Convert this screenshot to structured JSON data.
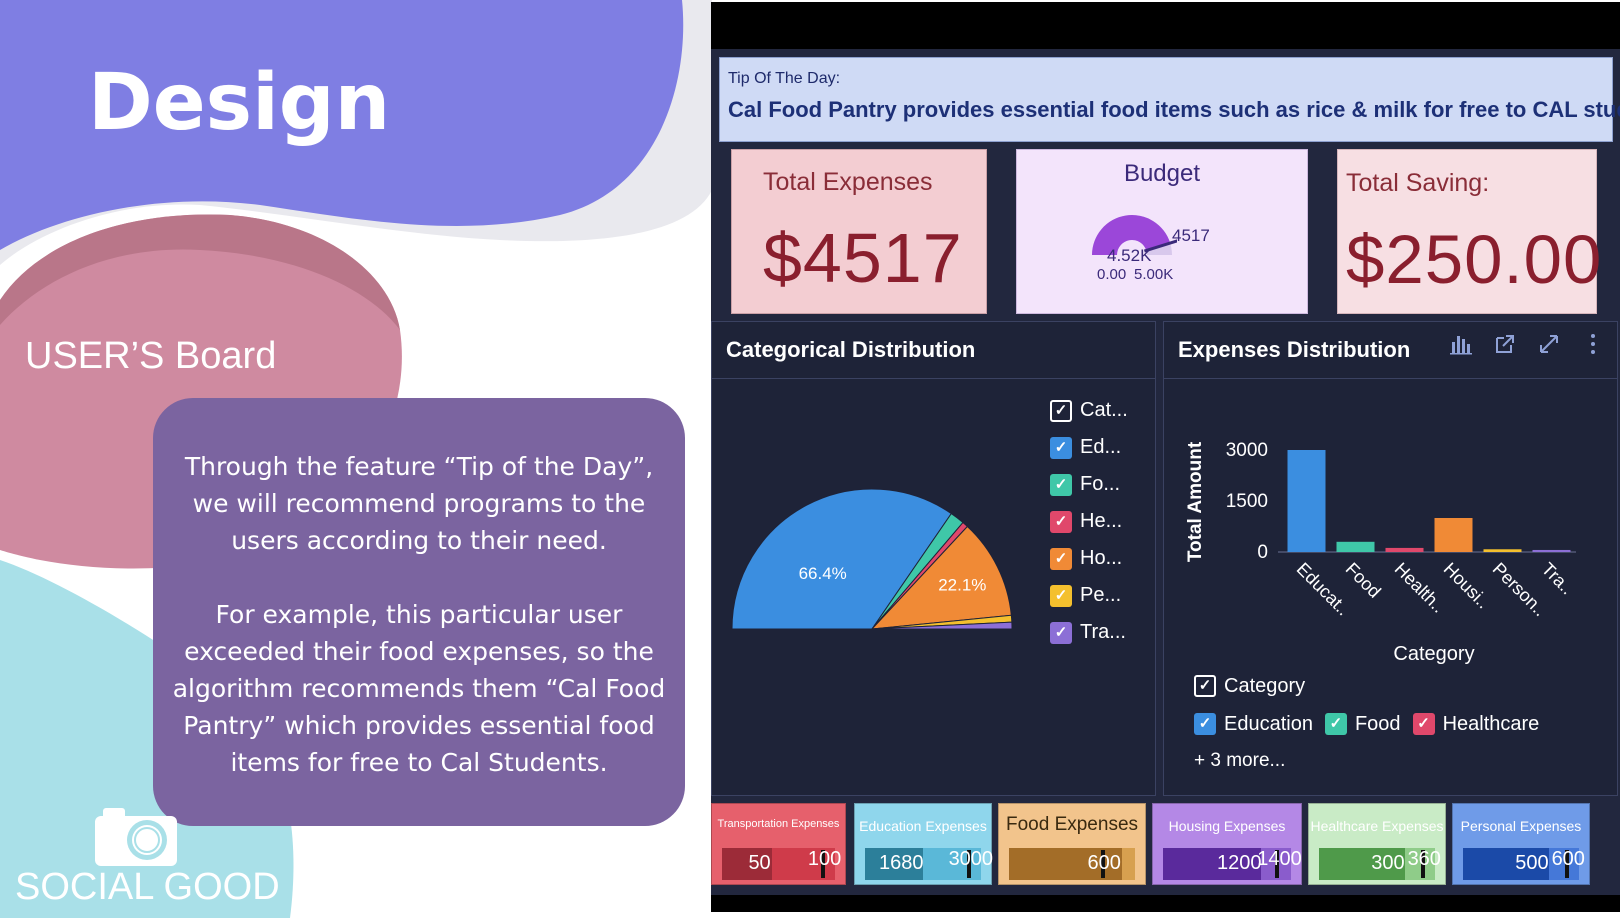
{
  "slide": {
    "title": "Design",
    "section_label": "USER’S Board",
    "description": [
      "Through the feature “Tip of the Day”, we will recommend programs to the users according to their need.",
      "For example, this particular user exceeded their food expenses, so the algorithm recommends them “Cal Food Pantry” which provides essential food items for free to Cal Students."
    ],
    "footer_text": "SOCIAL GOOD",
    "footer_icon": "camera-icon",
    "colors": {
      "purple_blob": "#7f7ee3",
      "pink_blob": "#cf8aa0",
      "teal_blob": "#a9e0e8",
      "desc_box": "#7b64a0"
    }
  },
  "dashboard": {
    "tip": {
      "label": "Tip Of The Day:",
      "text": "Cal Food Pantry provides essential food items such as rice & milk for free to CAL students"
    },
    "kpis": {
      "total_expenses": {
        "label": "Total Expenses",
        "value": "$4517"
      },
      "budget": {
        "label": "Budget",
        "gauge_value_text": "4.52K",
        "marker_text": "4517",
        "min_text": "0.00",
        "max_text": "5.00K",
        "value": 4517,
        "max": 5000
      },
      "total_saving": {
        "label": "Total Saving:",
        "value": "$250.00"
      }
    },
    "categorical": {
      "title": "Categorical Distribution",
      "legend_header": "Cat...",
      "legend": [
        {
          "label": "Ed...",
          "color": "#3b8ee0"
        },
        {
          "label": "Fo...",
          "color": "#3fc7a8"
        },
        {
          "label": "He...",
          "color": "#e0486b"
        },
        {
          "label": "Ho...",
          "color": "#f08a36"
        },
        {
          "label": "Pe...",
          "color": "#f4c02e"
        },
        {
          "label": "Tra...",
          "color": "#8c6fd6"
        }
      ]
    },
    "expenses": {
      "title": "Expenses Distribution",
      "icons": [
        "bar-chart-icon",
        "external-link-icon",
        "expand-icon",
        "more-vertical-icon"
      ],
      "legend_header": "Category",
      "legend": [
        {
          "label": "Education",
          "color": "#3b8ee0"
        },
        {
          "label": "Food",
          "color": "#3fc7a8"
        },
        {
          "label": "Healthcare",
          "color": "#e0486b"
        }
      ],
      "more_text": "+ 3 more..."
    },
    "cards": [
      {
        "title": "Transportation Expenses",
        "value_text": "50",
        "target_text": "100",
        "bg": "#e6606c",
        "fill": "#9c2b38",
        "track": "#cf3b4a",
        "value": 50,
        "target": 100
      },
      {
        "title": "Education Expenses",
        "value_text": "1680",
        "target_text": "3000",
        "bg": "#8fd6ec",
        "fill": "#2c7f9a",
        "track": "#5ab8d8",
        "value": 1680,
        "target": 3000
      },
      {
        "title": "Food Expenses",
        "value_text": "600",
        "target_text": "",
        "bg": "#f2c48c",
        "fill": "#a36d28",
        "track": "#d7a04f",
        "value": 600,
        "target": 500
      },
      {
        "title": "Housing Expenses",
        "value_text": "1200",
        "target_text": "1400",
        "bg": "#b488e6",
        "fill": "#5a2a9c",
        "track": "#8a5ccc",
        "value": 1200,
        "target": 1400
      },
      {
        "title": "Healthcare Expenses",
        "value_text": "300",
        "target_text": "360",
        "bg": "#c9ebc6",
        "fill": "#4f9a4a",
        "track": "#8fcc89",
        "value": 300,
        "target": 360
      },
      {
        "title": "Personal Expenses",
        "value_text": "500",
        "target_text": "600",
        "bg": "#6f9be8",
        "fill": "#1b4aa8",
        "track": "#4578d8",
        "value": 500,
        "target": 600
      }
    ]
  },
  "chart_data": [
    {
      "type": "pie",
      "title": "Categorical Distribution",
      "legend": "right",
      "categories": [
        "Education",
        "Food",
        "Healthcare",
        "Housing",
        "Personal",
        "Transportation"
      ],
      "values": [
        66.4,
        3.2,
        1.3,
        22.1,
        1.5,
        1.5
      ],
      "value_labels": [
        "66.4%",
        "",
        "",
        "22.1%",
        "",
        ""
      ],
      "colors": [
        "#3b8ee0",
        "#3fc7a8",
        "#e0486b",
        "#f08a36",
        "#f4c02e",
        "#8c6fd6"
      ]
    },
    {
      "type": "bar",
      "title": "Expenses Distribution",
      "xlabel": "Category",
      "ylabel": "Total Amount",
      "categories": [
        "Educat..",
        "Food",
        "Health..",
        "Housi..",
        "Person..",
        "Tra.."
      ],
      "values": [
        3000,
        300,
        120,
        1000,
        80,
        60
      ],
      "colors": [
        "#3b8ee0",
        "#3fc7a8",
        "#e0486b",
        "#f08a36",
        "#f4c02e",
        "#8c6fd6"
      ],
      "yticks": [
        "0",
        "1500",
        "3000"
      ],
      "ylim": [
        0,
        3000
      ],
      "grid": false
    }
  ]
}
